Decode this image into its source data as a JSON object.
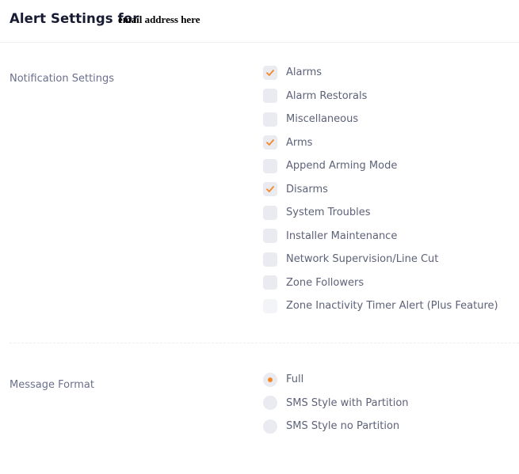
{
  "header": {
    "title": "Alert Settings for",
    "email": "email address here"
  },
  "notification": {
    "label": "Notification Settings",
    "options": [
      {
        "label": "Alarms",
        "checked": true,
        "disabled": false
      },
      {
        "label": "Alarm Restorals",
        "checked": false,
        "disabled": false
      },
      {
        "label": "Miscellaneous",
        "checked": false,
        "disabled": false
      },
      {
        "label": "Arms",
        "checked": true,
        "disabled": false
      },
      {
        "label": "Append Arming Mode",
        "checked": false,
        "disabled": false
      },
      {
        "label": "Disarms",
        "checked": true,
        "disabled": false
      },
      {
        "label": "System Troubles",
        "checked": false,
        "disabled": false
      },
      {
        "label": "Installer Maintenance",
        "checked": false,
        "disabled": false
      },
      {
        "label": "Network Supervision/Line Cut",
        "checked": false,
        "disabled": false
      },
      {
        "label": "Zone Followers",
        "checked": false,
        "disabled": false
      },
      {
        "label": "Zone Inactivity Timer Alert (Plus Feature)",
        "checked": false,
        "disabled": true
      }
    ]
  },
  "message_format": {
    "label": "Message Format",
    "options": [
      {
        "label": "Full",
        "selected": true
      },
      {
        "label": "SMS Style with Partition",
        "selected": false
      },
      {
        "label": "SMS Style no Partition",
        "selected": false
      }
    ]
  },
  "colors": {
    "accent": "#f3892b",
    "control_bg": "#e9ebf1",
    "label_text": "#5e6278",
    "title_text": "#181c32"
  }
}
